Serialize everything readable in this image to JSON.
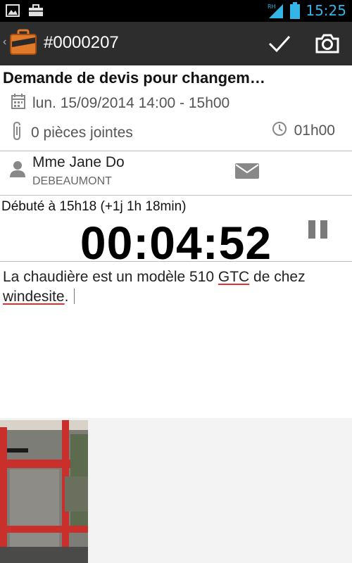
{
  "status_bar": {
    "left_icons": [
      "image-icon",
      "briefcase-icon"
    ],
    "right_icons": [
      "signal-icon",
      "battery-icon"
    ],
    "signal_label": "RH",
    "time": "15:25"
  },
  "action_bar": {
    "back_icon": "chevron-left-icon",
    "title": "#0000207",
    "actions": [
      "check-icon",
      "camera-icon"
    ]
  },
  "intervention": {
    "title": "Demande de devis pour changem…",
    "date": "lun. 15/09/2014 14:00 - 15h00",
    "attachments": "0 pièces jointes",
    "duration": "01h00"
  },
  "contact": {
    "name": "Mme Jane Do",
    "company": "DEBEAUMONT"
  },
  "timer": {
    "started": "Débuté à 15h18 (+1j 1h 18min)",
    "elapsed": "00:04:52"
  },
  "notes": {
    "part1": "La chaudière est un modèle 510 ",
    "word1": "GTC",
    "part2": " de chez ",
    "word2": "windesite",
    "part3": "."
  },
  "colors": {
    "accent": "#35b5e5",
    "action_bar": "#2d2d2d",
    "spell_underline": "#e53030"
  }
}
